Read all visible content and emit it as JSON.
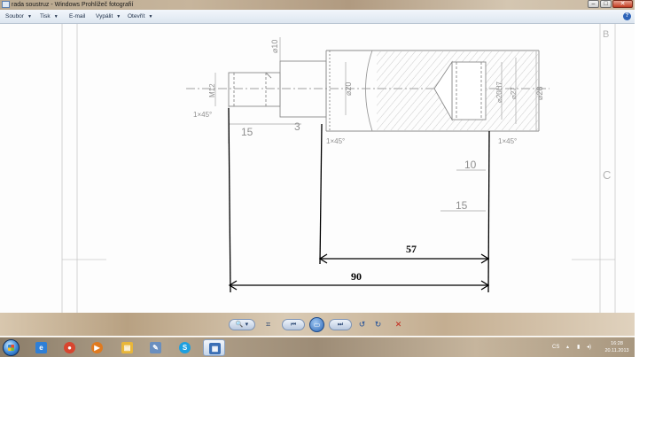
{
  "window": {
    "title": "rada soustruz - Windows Prohlížeč fotografií",
    "controls": {
      "minimize": "–",
      "maximize": "□",
      "close": "✕"
    }
  },
  "menu": [
    {
      "label": "Soubor",
      "has_arrow": true
    },
    {
      "label": "Tisk",
      "has_arrow": true
    },
    {
      "label": "E-mail",
      "has_arrow": false
    },
    {
      "label": "Vypálit",
      "has_arrow": true
    },
    {
      "label": "Otevřít",
      "has_arrow": true
    }
  ],
  "help_label": "?",
  "drawing": {
    "dims": {
      "d10": "⌀10",
      "m12": "M12",
      "d20": "⌀20",
      "d20h": "⌀20H7",
      "d27": "⌀27",
      "d28": "⌀28",
      "chamfer_left": "1×45°",
      "chamfer_mid": "1×45°",
      "chamfer_right": "1×45°",
      "len_15_left": "15",
      "len_3": "3",
      "len_10": "10",
      "len_15_right": "15"
    },
    "added": {
      "dim_57": "57",
      "dim_90": "90"
    },
    "border_letters": {
      "b": "B",
      "c": "C"
    }
  },
  "control_bar": {
    "zoom": "🔍 ▾",
    "fit": "⌗",
    "prev": "⏮",
    "slideshow": "▭",
    "next": "⏭",
    "rotate_ccw": "↺",
    "rotate_cw": "↻",
    "delete": "✕"
  },
  "taskbar": {
    "items": [
      {
        "icon": "ie-icon",
        "glyph": "e",
        "color": "#2f7fd6"
      },
      {
        "icon": "chrome-icon",
        "glyph": "●",
        "color": "#d8452f"
      },
      {
        "icon": "media-player-icon",
        "glyph": "▶",
        "color": "#e07a1f"
      },
      {
        "icon": "folder-icon",
        "glyph": "▤",
        "color": "#e8b63a"
      },
      {
        "icon": "tool-icon",
        "glyph": "✎",
        "color": "#6a8fbf"
      },
      {
        "icon": "skype-icon",
        "glyph": "S",
        "color": "#1ea0e0"
      },
      {
        "icon": "photo-viewer-icon",
        "glyph": "▦",
        "color": "#3b6fb5"
      }
    ],
    "tray": {
      "language": "CS",
      "arrow": "▴",
      "icons": [
        "▮",
        "◂)"
      ],
      "time": "16:28",
      "date": "20.11.2013"
    }
  }
}
